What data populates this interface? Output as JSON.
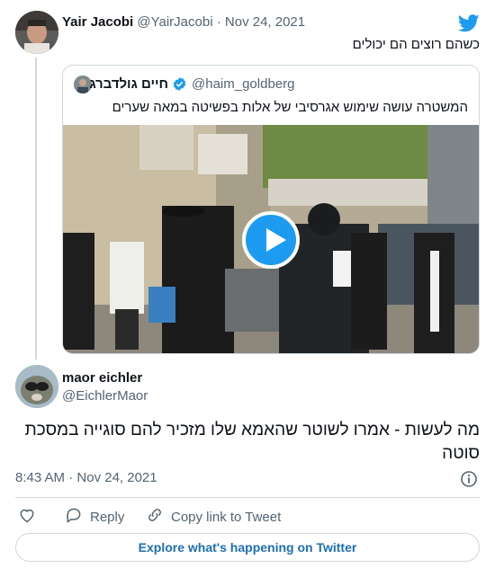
{
  "tweet": {
    "author_name": "Yair Jacobi",
    "author_handle": "@YairJacobi",
    "separator": "·",
    "date": "Nov 24, 2021",
    "text": "כשהם רוצים הם יכולים"
  },
  "quote": {
    "author_name": "חיים גולדברג",
    "author_handle": "@haim_goldberg",
    "text": "המשטרה עושה שימוש אגרסיבי של אלות בפשיטה במאה שערים"
  },
  "reply": {
    "author_name": "maor eichler",
    "author_handle": "@EichlerMaor",
    "text": "מה לעשות - אמרו לשוטר שהאמא שלו מזכיר להם סוגייה במסכת סוטה",
    "time": "8:43 AM",
    "separator": "·",
    "date": "Nov 24, 2021"
  },
  "actions": {
    "reply_label": "Reply",
    "copy_link_label": "Copy link to Tweet"
  },
  "explore_label": "Explore what's happening on Twitter",
  "colors": {
    "twitter_blue": "#1d9bf0",
    "text_primary": "#0f1419",
    "text_secondary": "#536471",
    "border": "#cfd9de",
    "link": "#1d6fb0"
  },
  "icons": [
    "twitter-bird-icon",
    "verified-badge-icon",
    "play-icon",
    "info-icon",
    "heart-icon",
    "reply-icon",
    "link-icon"
  ]
}
